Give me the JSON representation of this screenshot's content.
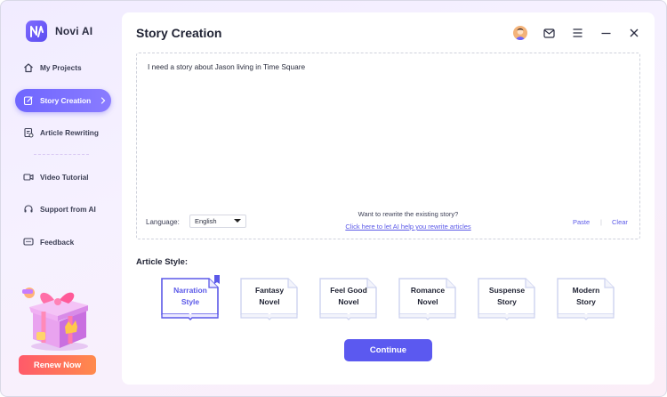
{
  "app": {
    "name": "Novi AI"
  },
  "sidebar": {
    "items": [
      {
        "label": "My Projects",
        "icon": "home-icon"
      },
      {
        "label": "Story Creation",
        "icon": "edit-icon",
        "active": true
      },
      {
        "label": "Article Rewriting",
        "icon": "document-icon"
      },
      {
        "label": "Video Tutorial",
        "icon": "video-icon"
      },
      {
        "label": "Support from AI",
        "icon": "headset-icon"
      },
      {
        "label": "Feedback",
        "icon": "chat-icon"
      }
    ],
    "renew_label": "Renew Now"
  },
  "header": {
    "title": "Story Creation"
  },
  "editor": {
    "text": "I need a story about Jason living in Time Square",
    "language_label": "Language:",
    "language_value": "English",
    "rewrite_question": "Want to rewrite the existing story?",
    "rewrite_link": "Click here to let AI help you rewrite articles",
    "paste_label": "Paste",
    "clear_label": "Clear"
  },
  "article_style": {
    "label": "Article Style:",
    "options": [
      {
        "line1": "Narration",
        "line2": "Style",
        "selected": true
      },
      {
        "line1": "Fantasy",
        "line2": "Novel"
      },
      {
        "line1": "Feel Good",
        "line2": "Novel"
      },
      {
        "line1": "Romance",
        "line2": "Novel"
      },
      {
        "line1": "Suspense",
        "line2": "Story"
      },
      {
        "line1": "Modern",
        "line2": "Story"
      }
    ]
  },
  "continue_label": "Continue",
  "colors": {
    "accent": "#5b59f0",
    "renew_start": "#ff5a6a",
    "renew_end": "#ff8a4c"
  }
}
